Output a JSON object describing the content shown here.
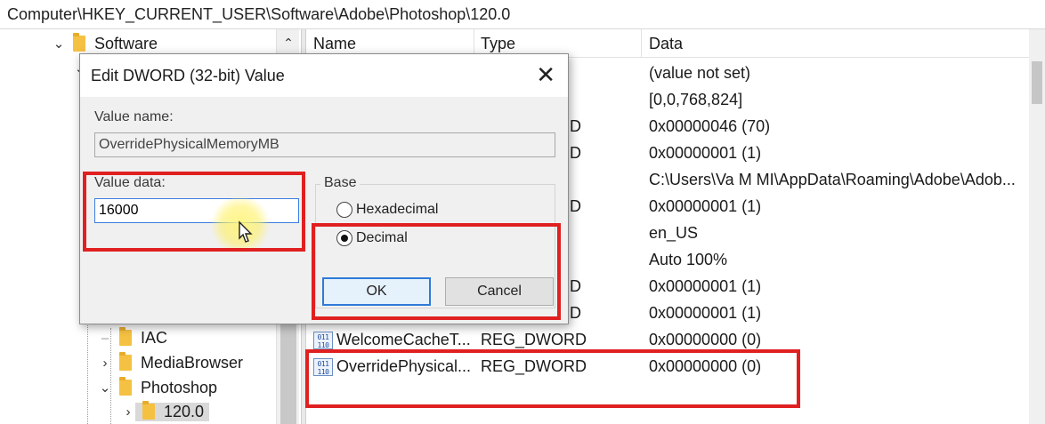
{
  "address": "Computer\\HKEY_CURRENT_USER\\Software\\Adobe\\Photoshop\\120.0",
  "tree": {
    "items": [
      {
        "label": "Software",
        "chevron": "expanded"
      },
      {
        "label": "IAC",
        "chevron": "none"
      },
      {
        "label": "MediaBrowser",
        "chevron": "collapsed"
      },
      {
        "label": "Photoshop",
        "chevron": "expanded"
      },
      {
        "label": "120.0",
        "chevron": "collapsed",
        "selected": true
      }
    ]
  },
  "list": {
    "columns": [
      "Name",
      "Type",
      "Data"
    ],
    "rows": [
      {
        "name": "",
        "type": "",
        "data": "(value not set)",
        "frag": ""
      },
      {
        "name": "",
        "type": "",
        "data": "[0,0,768,824]",
        "frag": ""
      },
      {
        "name": "",
        "type": "",
        "data": "0x00000046 (70)",
        "frag": "D"
      },
      {
        "name": "",
        "type": "",
        "data": "0x00000001 (1)",
        "frag": "D"
      },
      {
        "name": "",
        "type": "",
        "data": "C:\\Users\\Va M MI\\AppData\\Roaming\\Adobe\\Adob...",
        "frag": ""
      },
      {
        "name": "",
        "type": "",
        "data": "0x00000001 (1)",
        "frag": "D"
      },
      {
        "name": "",
        "type": "",
        "data": "en_US",
        "frag": ""
      },
      {
        "name": "",
        "type": "",
        "data": "Auto 100%",
        "frag": ""
      },
      {
        "name": "",
        "type": "",
        "data": "0x00000001 (1)",
        "frag": "D"
      },
      {
        "name": "",
        "type": "",
        "data": "0x00000001 (1)",
        "frag": "D"
      },
      {
        "name": "WelcomeCacheT...",
        "type": "REG_DWORD",
        "data": "0x00000000 (0)",
        "frag": "",
        "icon": "dword-icon"
      },
      {
        "name": "OverridePhysical...",
        "type": "REG_DWORD",
        "data": "0x00000000 (0)",
        "frag": "",
        "icon": "dword-icon"
      }
    ]
  },
  "dialog": {
    "title": "Edit DWORD (32-bit) Value",
    "close_glyph": "✕",
    "value_name_label": "Value name:",
    "value_name": "OverridePhysicalMemoryMB",
    "value_data_label": "Value data:",
    "value_data": "16000",
    "base_label": "Base",
    "base_options": [
      "Hexadecimal",
      "Decimal"
    ],
    "base_selected": "Decimal",
    "ok_label": "OK",
    "cancel_label": "Cancel"
  },
  "colors": {
    "highlight": "#e02020",
    "folder": "#f5c143",
    "focus": "#2f7ad9"
  }
}
